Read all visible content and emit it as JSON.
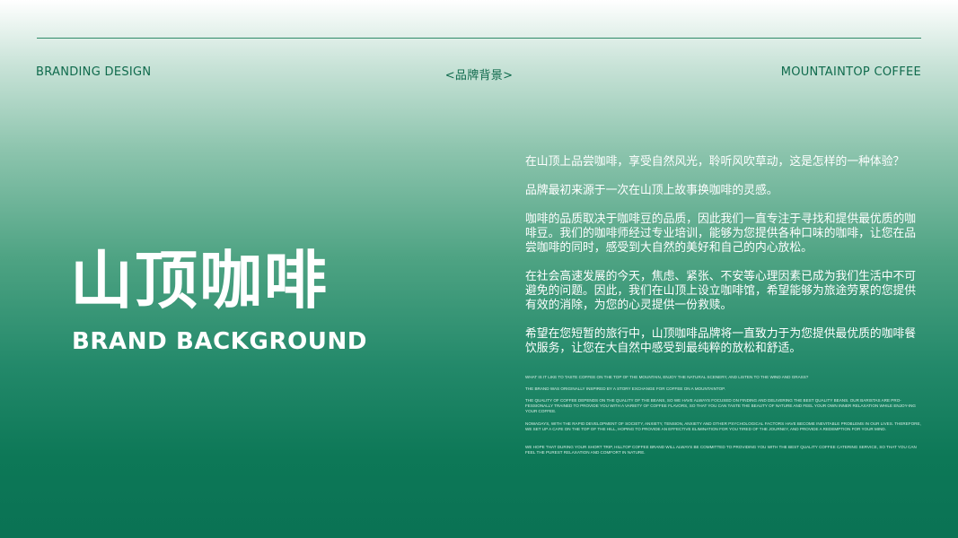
{
  "header": {
    "left": "BRANDING DESIGN",
    "center": "<品牌背景>",
    "right": "MOUNTAINTOP COFFEE"
  },
  "hero": {
    "title": "山顶咖啡",
    "subtitle": "BRAND BACKGROUND"
  },
  "body_zh": [
    "在山顶上品尝咖啡，享受自然风光，聆听风吹草动，这是怎样的一种体验？",
    "品牌最初来源于一次在山顶上故事换咖啡的灵感。",
    "咖啡的品质取决于咖啡豆的品质，因此我们一直专注于寻找和提供最优质的咖啡豆。我们的咖啡师经过专业培训，能够为您提供各种口味的咖啡，让您在品尝咖啡的同时，感受到大自然的美好和自己的内心放松。",
    "在社会高速发展的今天，焦虑、紧张、不安等心理因素已成为我们生活中不可避免的问题。因此，我们在山顶上设立咖啡馆，希望能够为旅途劳累的您提供有效的消除，为您的心灵提供一份救赎。",
    "希望在您短暂的旅行中，山顶咖啡品牌将一直致力于为您提供最优质的咖啡餐饮服务，让您在大自然中感受到最纯粹的放松和舒适。"
  ],
  "body_en": [
    "WHAT IS IT LIKE TO TASTE COFFEE ON THE TOP OF THE MOUNTAIN, ENJOY THE NATURAL SCENERY, AND LISTEN TO THE WIND AND GRASS?",
    "THE BRAND WAS ORIGINALLY INSPIRED BY A STORY EXCHANGE FOR COFFEE ON A MOUNTAINTOP.",
    "THE QUALITY OF COFFEE DEPENDS ON THE QUALITY OF THE BEANS, SO WE HAVE ALWAYS FOCUSED ON FINDING AND DELIVERING THE BEST QUALITY BEANS. OUR BARISTAS ARE PRO-FESSIONALLY TRAINED TO PROVIDE YOU WITH A VARIETY OF COFFEE FLAVORS, SO THAT YOU CAN TASTE THE BEAUTY OF NATURE AND FEEL YOUR OWN INNER RELAXATION WHILE ENJOY-ING YOUR COFFEE.",
    "NOWADAYS, WITH THE RAPID DEVELOPMENT OF SOCIETY, ANXIETY, TENSION, ANXIETY AND OTHER PSYCHOLOGICAL FACTORS HAVE BECOME INEVITABLE PROBLEMS IN OUR LIVES. THEREFORE, WE SET UP A CAFE ON THE TOP OF THE HILL, HOPING TO PROVIDE AN EFFECTIVE ELIMINATION FOR YOU TIRED OF THE JOURNEY, AND PROVIDE A REDEMPTION FOR YOUR MIND.",
    "WE HOPE THAT DURING YOUR SHORT TRIP, HILLTOP COFFEE BRAND WILL ALWAYS BE COMMITTED TO PROVIDING YOU WITH THE BEST QUALITY COFFEE CATERING SERVICE, SO THAT YOU CAN FEEL THE PUREST RELAXATION AND COMFORT IN NATURE."
  ],
  "colors": {
    "accent": "#0f6a4c",
    "bottom_green": "#0a7254"
  }
}
